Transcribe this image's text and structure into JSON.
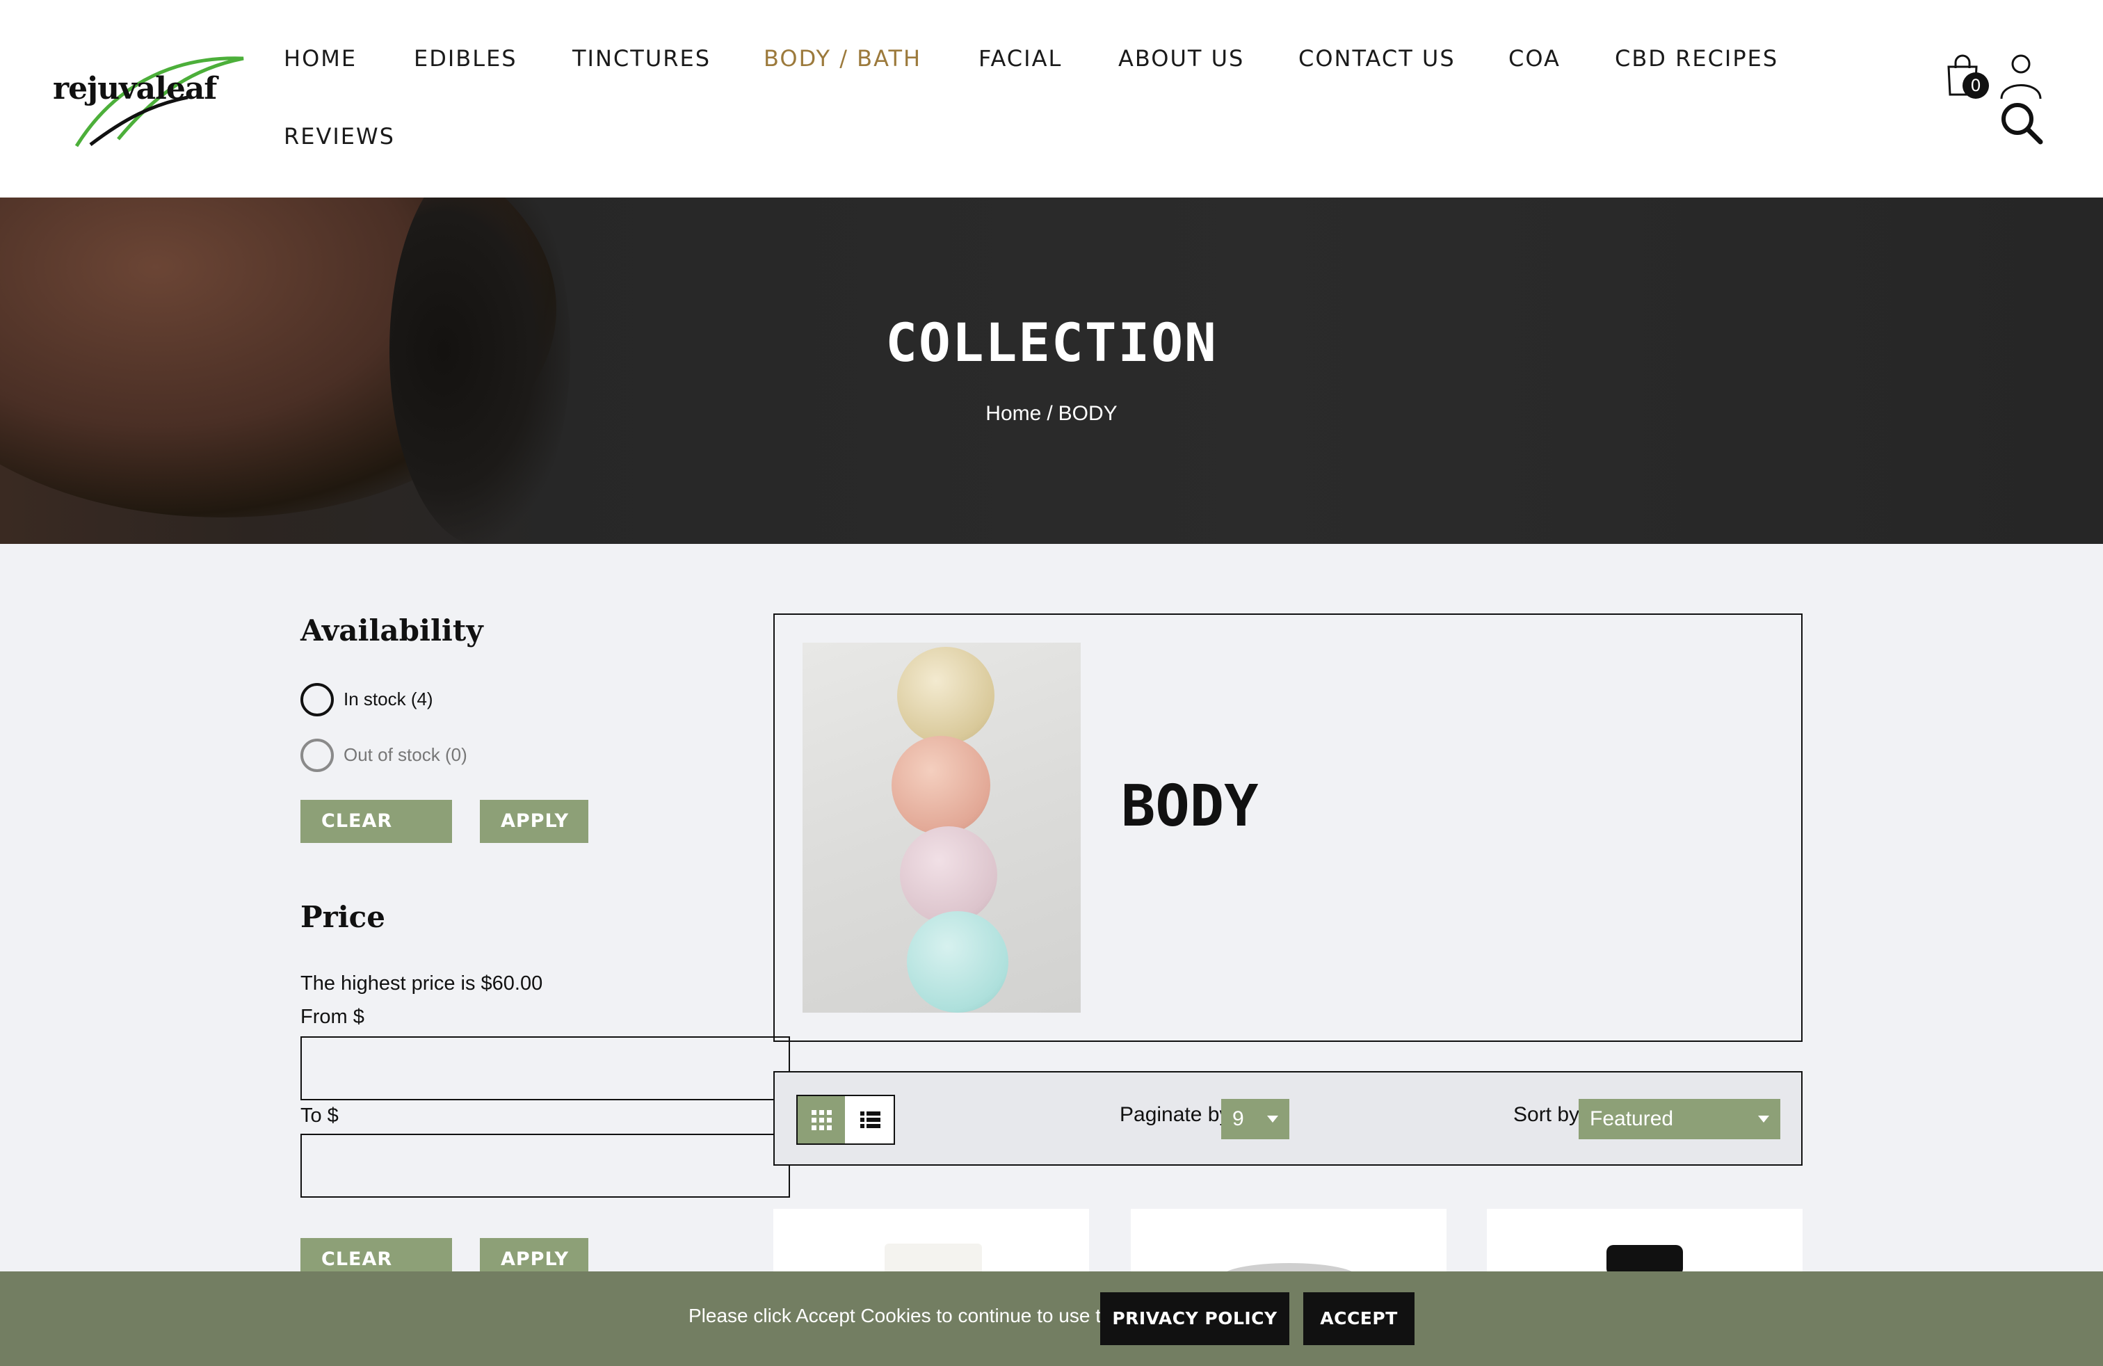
{
  "header": {
    "logo_text": "rejuvaleaf",
    "nav": [
      {
        "label": "HOME",
        "active": false
      },
      {
        "label": "EDIBLES",
        "active": false
      },
      {
        "label": "TINCTURES",
        "active": false
      },
      {
        "label": "BODY / BATH",
        "active": true
      },
      {
        "label": "FACIAL",
        "active": false
      },
      {
        "label": "ABOUT US",
        "active": false
      },
      {
        "label": "CONTACT US",
        "active": false
      },
      {
        "label": "COA",
        "active": false
      },
      {
        "label": "CBD RECIPES",
        "active": false
      },
      {
        "label": "REVIEWS",
        "active": false
      }
    ],
    "cart_count": "0",
    "icons": [
      "cart-icon",
      "account-icon",
      "search-icon"
    ],
    "active_color": "#9c7a3c"
  },
  "hero": {
    "title": "COLLECTION",
    "breadcrumb": {
      "home": "Home",
      "separator": "/",
      "current": "BODY"
    }
  },
  "filters": {
    "availability": {
      "heading": "Availability",
      "options": [
        {
          "label": "In stock (4)",
          "enabled": true
        },
        {
          "label": "Out of stock (0)",
          "enabled": false
        }
      ],
      "clear_label": "CLEAR",
      "apply_label": "APPLY"
    },
    "price": {
      "heading": "Price",
      "highest_text": "The highest price is $60.00",
      "from_label": "From $",
      "from_value": "",
      "to_label": "To $",
      "to_value": "",
      "clear_label": "CLEAR",
      "apply_label": "APPLY"
    }
  },
  "collection": {
    "title": "BODY"
  },
  "toolbar": {
    "paginate_label": "Paginate by",
    "paginate_value": "9",
    "sort_label": "Sort by",
    "sort_value": "Featured",
    "view_modes": [
      "grid",
      "list"
    ],
    "active_view": "grid"
  },
  "cookie": {
    "message": "Please click Accept Cookies to continue to use the site.",
    "privacy_label": "PRIVACY POLICY",
    "accept_label": "ACCEPT"
  },
  "colors": {
    "accent_green": "#8da077",
    "cookie_bar": "#737e62",
    "hero_bg": "#2b2b2b",
    "page_bg": "#f1f2f5"
  }
}
